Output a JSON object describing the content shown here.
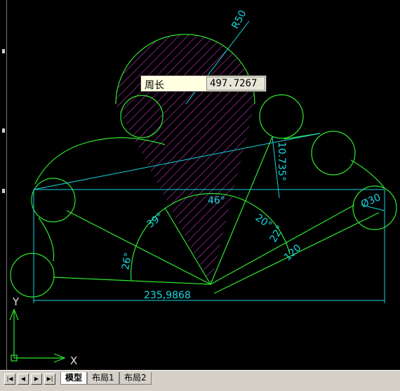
{
  "measure_tooltip": {
    "label": "周长",
    "value": "497.7267"
  },
  "dimensions": {
    "radius": "R50",
    "vertical": "10.735°",
    "diameter": "Ø30",
    "length": "120",
    "horizontal": "235,9868",
    "angle_26": "26°",
    "angle_39": "39°",
    "angle_46": "46°",
    "angle_20": "20°",
    "angle_22": "22°"
  },
  "ucs": {
    "x_label": "X",
    "y_label": "Y"
  },
  "nav_buttons": [
    "|◀",
    "◀",
    "▶",
    "▶|"
  ],
  "layout_tabs": [
    {
      "label": "模型",
      "active": true
    },
    {
      "label": "布局1",
      "active": false
    },
    {
      "label": "布局2",
      "active": false
    }
  ],
  "colors": {
    "outline": "#2ee82e",
    "construction": "#19d5e0",
    "hatch": "#cc33cc",
    "background": "#000000"
  }
}
